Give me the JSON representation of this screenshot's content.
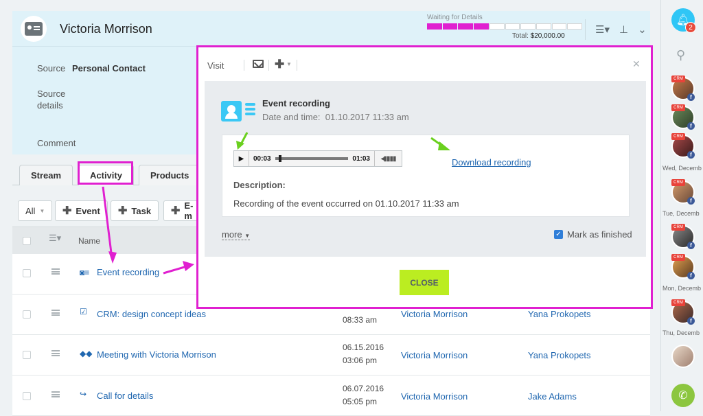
{
  "header": {
    "title": "Victoria Morrison",
    "stage_label": "Waiting for Details",
    "total_label": "Total:",
    "total_value": "$20,000.00"
  },
  "details": {
    "source_label": "Source",
    "source_value": "Personal Contact",
    "source_details_label": "Source details",
    "comment_label": "Comment"
  },
  "tabs": [
    "Stream",
    "Activity",
    "Products"
  ],
  "filter": {
    "all_label": "All",
    "event_label": "Event",
    "task_label": "Task",
    "email_label": "E-m"
  },
  "grid": {
    "name_header": "Name",
    "rows": [
      {
        "name": "Event recording",
        "date": "",
        "time": "",
        "client": "",
        "responsible": ""
      },
      {
        "name": "CRM: design concept ideas",
        "date": "",
        "time": "08:33 am",
        "client": "Victoria Morrison",
        "responsible": "Yana Prokopets"
      },
      {
        "name": "Meeting with Victoria Morrison",
        "date": "06.15.2016",
        "time": "03:06 pm",
        "client": "Victoria Morrison",
        "responsible": "Yana Prokopets"
      },
      {
        "name": "Call for details",
        "date": "06.07.2016",
        "time": "05:05 pm",
        "client": "Victoria Morrison",
        "responsible": "Jake Adams"
      }
    ]
  },
  "dialog": {
    "type_label": "Visit",
    "event_title": "Event recording",
    "date_label": "Date and time:",
    "date_value": "01.10.2017 11:33 am",
    "player_elapsed": "00:03",
    "player_duration": "01:03",
    "download_label": "Download recording",
    "description_label": "Description:",
    "description_text": "Recording of the event occurred on 01.10.2017 11:33 am",
    "more_label": "more",
    "mark_finished_label": "Mark as finished",
    "close_label": "CLOSE"
  },
  "sidebar": {
    "notification_count": "2",
    "day_labels": [
      "Wed, Decemb",
      "Tue, Decemb",
      "Mon, Decemb",
      "Thu, Decemb"
    ],
    "crm_tag": "CRM"
  },
  "colors": {
    "highlight": "#e020d0",
    "accent_blue": "#2fc6f6",
    "close_button": "#bbed21",
    "arrow_green": "#6ad01e"
  },
  "stage_progress": 0.4,
  "player_progress": 0.05
}
